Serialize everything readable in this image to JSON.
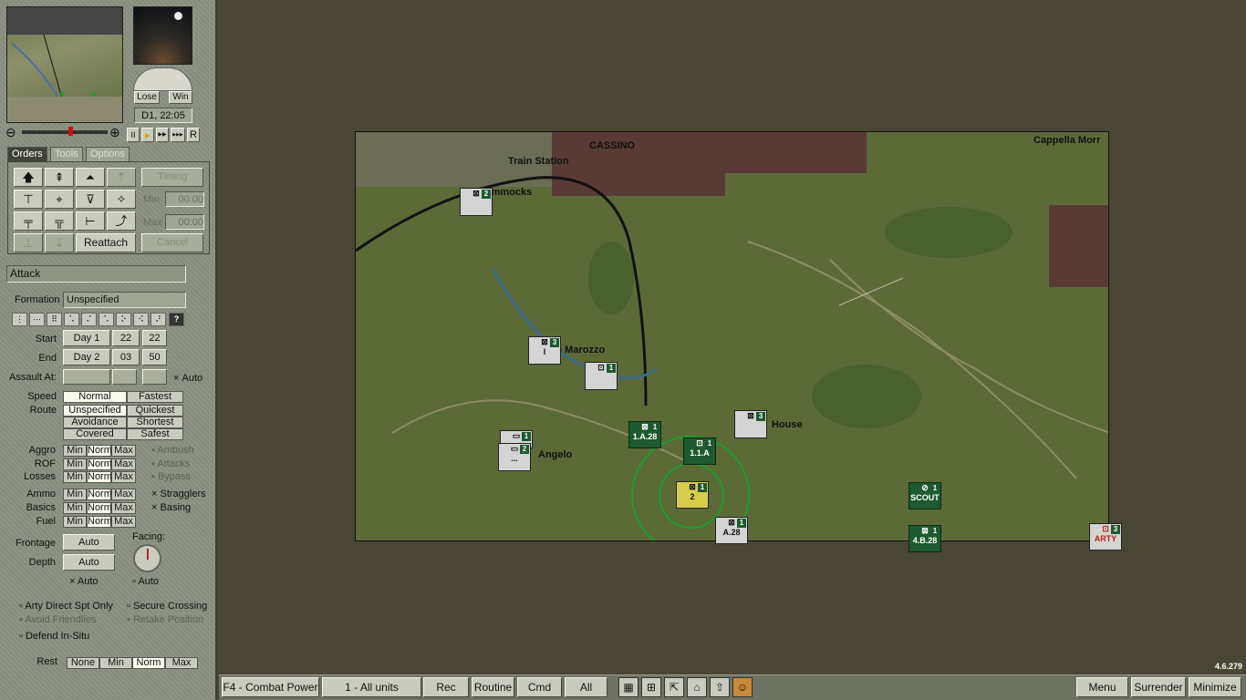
{
  "version": "4.6.279",
  "gauge": {
    "lose_label": "Lose",
    "win_label": "Win",
    "time": "D1, 22:05"
  },
  "playback": {
    "pause": "II",
    "play": "▶",
    "ffwd": "▶▶",
    "fastest": "▶▶▶",
    "replay": "R"
  },
  "tabs": [
    {
      "label": "Orders"
    },
    {
      "label": "Tools"
    },
    {
      "label": "Options"
    }
  ],
  "orders": {
    "timing_label": "Timing",
    "min_label": "Min",
    "min_value": "00:00",
    "max_label": "Max",
    "max_value": "00:00",
    "reattach_label": "Reattach",
    "cancel_label": "Cancel"
  },
  "order_name": "Attack",
  "formation": {
    "label": "Formation",
    "value": "Unspecified"
  },
  "start": {
    "label": "Start",
    "day": "Day 1",
    "hour": "22",
    "minute": "22"
  },
  "end": {
    "label": "End",
    "day": "Day 2",
    "hour": "03",
    "minute": "50"
  },
  "assault": {
    "label": "Assault At:",
    "auto_label": "Auto"
  },
  "speed": {
    "label": "Speed",
    "options": [
      "Normal",
      "Fastest"
    ]
  },
  "route": {
    "label": "Route",
    "options": [
      "Unspecified",
      "Quickest",
      "Avoidance",
      "Shortest",
      "Covered",
      "Safest"
    ]
  },
  "levels": [
    {
      "label": "Aggro",
      "opts": [
        "Min",
        "Norm",
        "Max"
      ],
      "check": "Ambush"
    },
    {
      "label": "ROF",
      "opts": [
        "Min",
        "Norm",
        "Max"
      ],
      "check": "Attacks"
    },
    {
      "label": "Losses",
      "opts": [
        "Min",
        "Norm",
        "Max"
      ],
      "check": "Bypass"
    },
    {
      "label": "Ammo",
      "opts": [
        "Min",
        "Norm",
        "Max"
      ],
      "check": "Stragglers"
    },
    {
      "label": "Basics",
      "opts": [
        "Min",
        "Norm",
        "Max"
      ],
      "check": "Basing"
    },
    {
      "label": "Fuel",
      "opts": [
        "Min",
        "Norm",
        "Max"
      ],
      "check": ""
    }
  ],
  "facing_label": "Facing:",
  "frontage": {
    "label": "Frontage",
    "value": "Auto"
  },
  "depth": {
    "label": "Depth",
    "value": "Auto"
  },
  "auto_checks": [
    "Auto",
    "Auto"
  ],
  "options": {
    "arty": "Arty Direct Spt Only",
    "secure": "Secure Crossing",
    "avoid": "Avoid Friendlies",
    "retake": "Retake Position",
    "defend": "Defend In-Situ"
  },
  "rest": {
    "label": "Rest",
    "options": [
      "None",
      "Min",
      "Norm",
      "Max"
    ]
  },
  "map": {
    "places": [
      "CASSINO",
      "Train Station",
      "Cappella Morr",
      "Gimmocks",
      "e Marozzo",
      "Angelo",
      "House"
    ],
    "units": [
      {
        "num": "2",
        "sub": ""
      },
      {
        "num": "3",
        "sub": "I"
      },
      {
        "num": "1",
        "sub": ""
      },
      {
        "num": "1",
        "sub": ""
      },
      {
        "num": "2",
        "sub": "..."
      },
      {
        "num": "3",
        "sub": ""
      },
      {
        "num": "1",
        "sub": "1.A.28"
      },
      {
        "num": "1",
        "sub": "1.1.A"
      },
      {
        "num": "1",
        "sub": "2"
      },
      {
        "num": "1",
        "sub": "A.28"
      },
      {
        "num": "1",
        "sub": "SCOUT"
      },
      {
        "num": "1",
        "sub": "4.B.28"
      },
      {
        "num": "3",
        "sub": "ARTY"
      }
    ]
  },
  "bottom": {
    "combat_power": "F4 - Combat Power",
    "all_units": "1 - All units",
    "rec": "Rec",
    "routine": "Routine",
    "cmd": "Cmd",
    "all": "All",
    "menu": "Menu",
    "surrender": "Surrender",
    "minimize": "Minimize"
  }
}
